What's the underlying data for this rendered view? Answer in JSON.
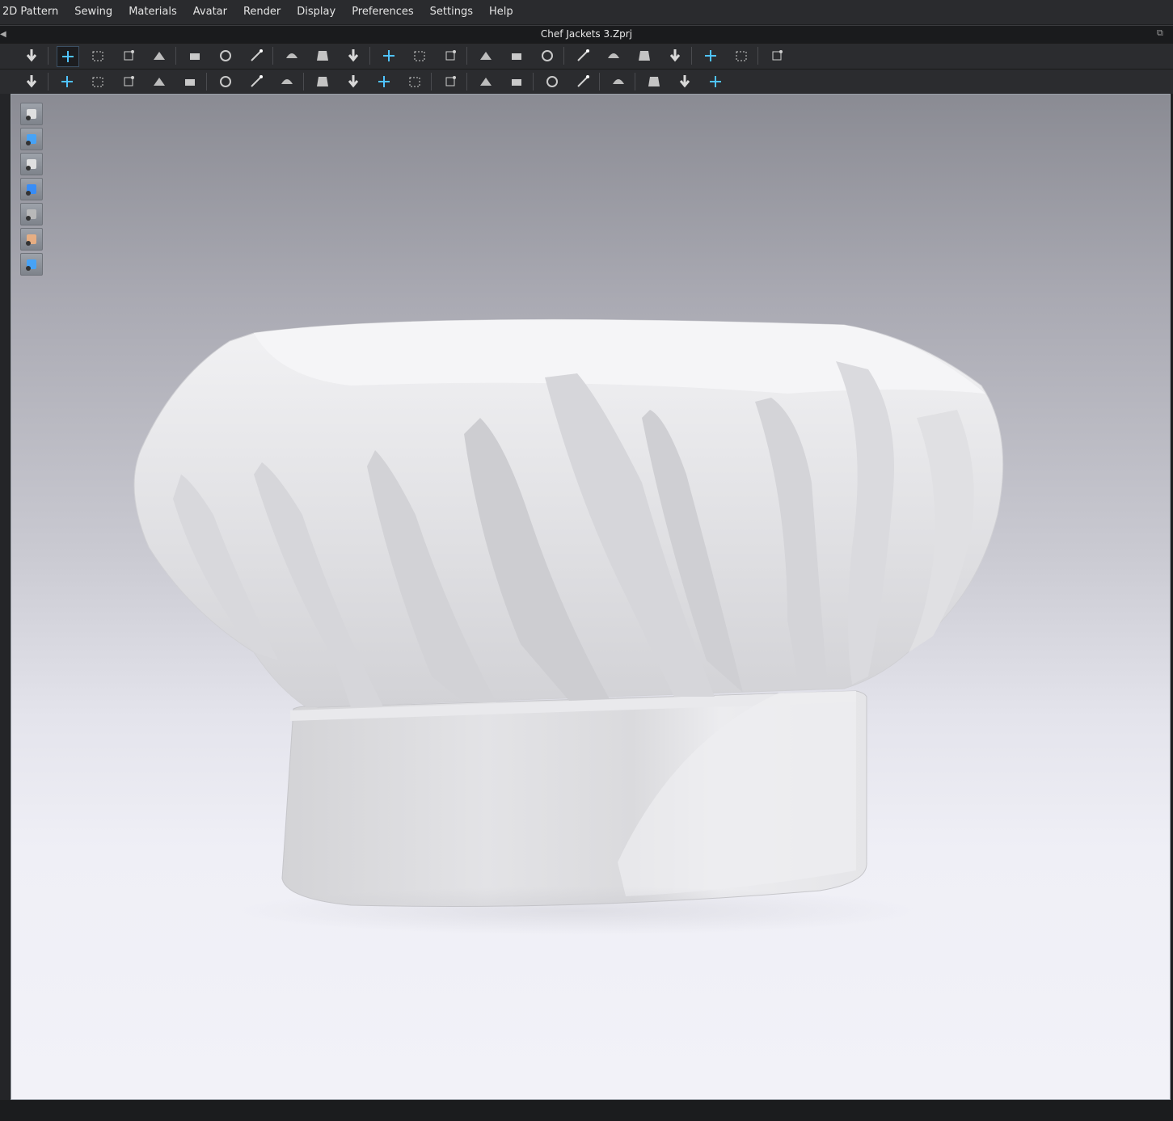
{
  "menu": {
    "items": [
      "2D Pattern",
      "Sewing",
      "Materials",
      "Avatar",
      "Render",
      "Display",
      "Preferences",
      "Settings",
      "Help"
    ]
  },
  "window": {
    "title": "Chef Jackets 3.Zprj"
  },
  "toolbar1": {
    "icons": [
      "simulation-icon",
      "select-move-icon",
      "select-mesh-box-icon",
      "transform-icon",
      "fold-arrange-icon",
      "tack-icon",
      "tack-on-avatar-icon",
      "tack-on-fabric-icon",
      "pin-icon",
      "fold-pin-icon",
      "cloth-pin-icon",
      "garment-fit-icon",
      "strap-icon",
      "avatar-pose-icon",
      "arrange-up-icon",
      "arrange-down-icon",
      "arrange-side-icon",
      "layer-icon",
      "layer-down-icon",
      "seamline-icon",
      "symmetric-icon",
      "measure-circle-icon",
      "tape-measure-icon",
      "ruler-icon"
    ]
  },
  "toolbar2": {
    "icons": [
      "avatar-walk-icon",
      "edit-measure-icon",
      "circumference-icon",
      "length-icon",
      "height-icon",
      "garment-measure-icon",
      "puckering-icon",
      "stitch-icon",
      "texture-icon",
      "button-icon",
      "buttonhole-icon",
      "line-icon",
      "snap-icon",
      "zipper-icon",
      "gradient-icon",
      "fabric-swatch-icon",
      "graphic-icon",
      "material-icon",
      "trim-icon",
      "size-icon",
      "flat-garment-icon",
      "garment-3d-icon"
    ]
  },
  "viewport": {
    "tools": [
      "show-garment-icon",
      "show-sewing-icon",
      "show-avatar-icon",
      "show-fabric-icon",
      "show-texture-icon",
      "avatar-skin-icon",
      "show-mesh-icon"
    ],
    "subject": "chef hat 3D garment"
  }
}
